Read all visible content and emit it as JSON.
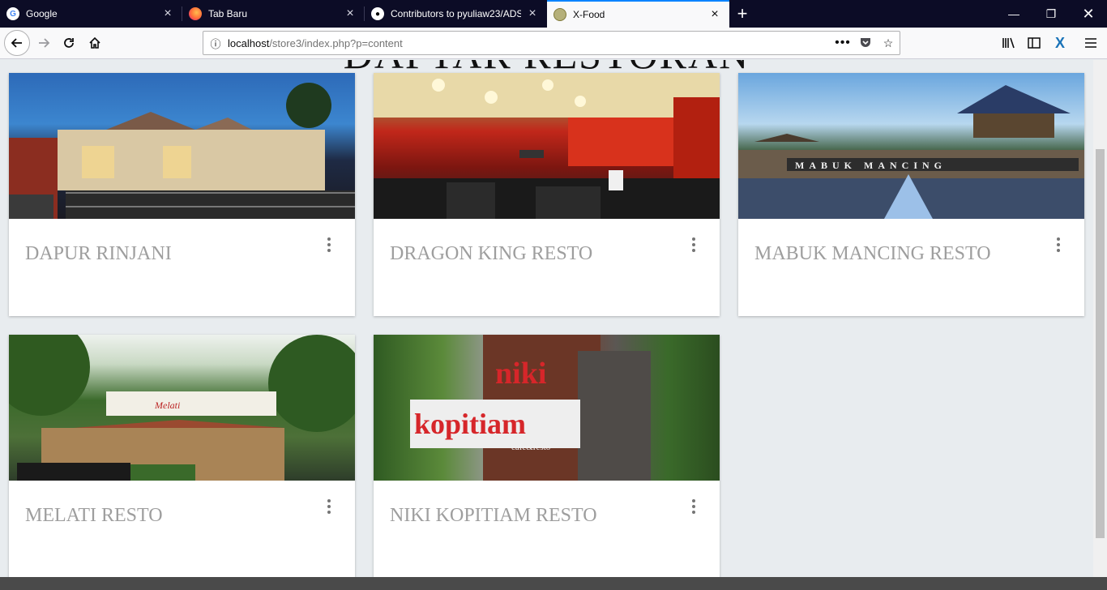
{
  "browser": {
    "tabs": [
      {
        "title": "Google",
        "favicon": "google-icon",
        "active": false
      },
      {
        "title": "Tab Baru",
        "favicon": "firefox-icon",
        "active": false
      },
      {
        "title": "Contributors to pyuliaw23/ADS",
        "favicon": "github-icon",
        "active": false
      },
      {
        "title": "X-Food",
        "favicon": "xfood-icon",
        "active": true
      }
    ],
    "new_tab_symbol": "+",
    "url_host": "localhost",
    "url_path": "/store3/index.php?p=content",
    "accent_color": "#0a84ff"
  },
  "page": {
    "heading": "DAFTAR RESTORAN",
    "restaurants": [
      {
        "name": "DAPUR RINJANI",
        "image": "dapur-rinjani-photo"
      },
      {
        "name": "DRAGON KING RESTO",
        "image": "dragon-king-photo"
      },
      {
        "name": "MABUK MANCING RESTO",
        "image": "mabuk-mancing-photo"
      },
      {
        "name": "MELATI RESTO",
        "image": "melati-photo"
      },
      {
        "name": "NIKI KOPITIAM RESTO",
        "image": "niki-kopitiam-photo"
      }
    ]
  }
}
